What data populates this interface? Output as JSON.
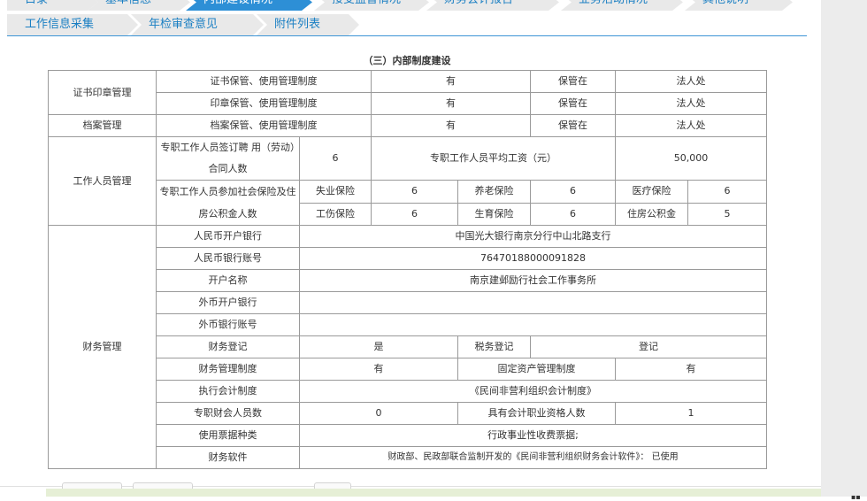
{
  "tabs_row1": [
    "目录",
    "基本信息",
    "内部建设情况",
    "接受监督情况",
    "财务会计报告",
    "业务活动情况",
    "其他说明"
  ],
  "tabs_row2": [
    "工作信息采集",
    "年检审查意见",
    "附件列表"
  ],
  "section_title": "（三）内部制度建设",
  "cert": {
    "group": "证书印章管理",
    "r1": {
      "name": "证书保管、使用管理制度",
      "value": "有",
      "kept_label": "保管在",
      "kept": "法人处"
    },
    "r2": {
      "name": "印章保管、使用管理制度",
      "value": "有",
      "kept_label": "保管在",
      "kept": "法人处"
    }
  },
  "archive": {
    "group": "档案管理",
    "name": "档案保管、使用管理制度",
    "value": "有",
    "kept_label": "保管在",
    "kept": "法人处"
  },
  "staff": {
    "group": "工作人员管理",
    "contract_label": "专职工作人员签订聘 用（劳动）合同人数",
    "contract_count": "6",
    "salary_label": "专职工作人员平均工资（元）",
    "salary": "50,000",
    "insurance_label": "专职工作人员参加社会保险及住房公积金人数",
    "unemployment_label": "失业保险",
    "unemployment": "6",
    "pension_label": "养老保险",
    "pension": "6",
    "medical_label": "医疗保险",
    "medical": "6",
    "injury_label": "工伤保险",
    "injury": "6",
    "maternity_label": "生育保险",
    "maternity": "6",
    "housing_label": "住房公积金",
    "housing": "5"
  },
  "finance": {
    "group": "财务管理",
    "rmb_bank_label": "人民币开户银行",
    "rmb_bank": "中国光大银行南京分行中山北路支行",
    "rmb_account_label": "人民币银行账号",
    "rmb_account": "76470188000091828",
    "account_name_label": "开户名称",
    "account_name": "南京建邺励行社会工作事务所",
    "fx_bank_label": "外币开户银行",
    "fx_bank": "",
    "fx_account_label": "外币银行账号",
    "fx_account": "",
    "fin_reg_label": "财务登记",
    "fin_reg": "是",
    "tax_reg_label": "税务登记",
    "tax_reg": "登记",
    "fin_policy_label": "财务管理制度",
    "fin_policy": "有",
    "asset_policy_label": "固定资产管理制度",
    "asset_policy": "有",
    "accounting_label": "执行会计制度",
    "accounting": "《民间非营利组织会计制度》",
    "accountants_label": "专职财会人员数",
    "accountants": "0",
    "qualified_label": "具有会计职业资格人数",
    "qualified": "1",
    "invoice_label": "使用票据种类",
    "invoice": "行政事业性收费票据;",
    "software_label": "财务软件",
    "software": "财政部、民政部联合监制开发的《民间非营利组织财务会计软件》： 已使用"
  },
  "colors": {
    "accent": "#2d8fd6",
    "tab_text": "#1a7fc3",
    "tab_bg": "#e9e9e9",
    "border": "#9a9a9a"
  }
}
